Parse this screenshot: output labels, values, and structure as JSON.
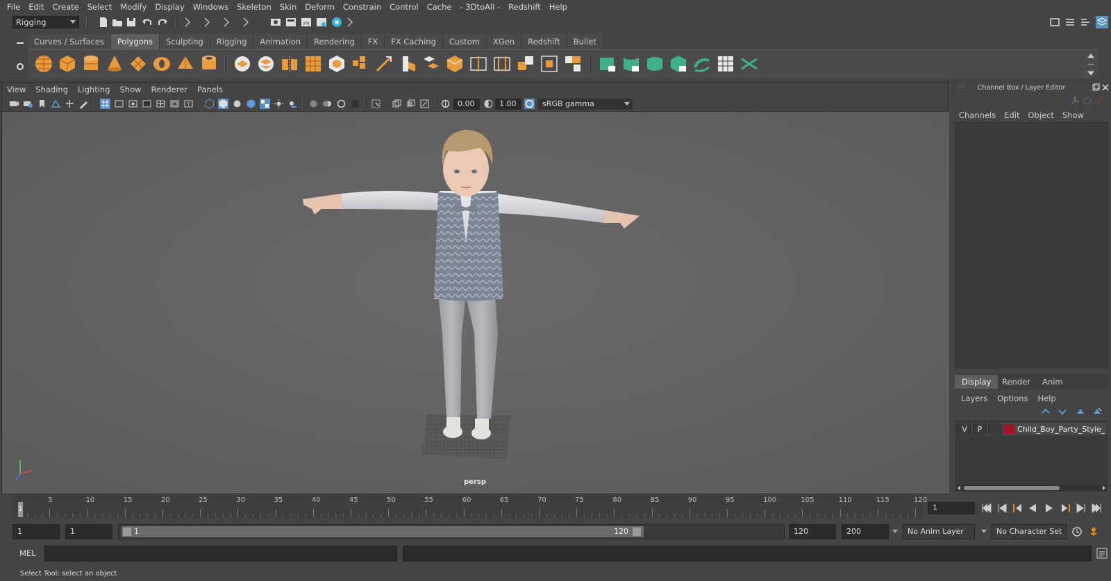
{
  "menubar": {
    "items": [
      "File",
      "Edit",
      "Create",
      "Select",
      "Modify",
      "Display",
      "Windows",
      "Skeleton",
      "Skin",
      "Deform",
      "Constrain",
      "Control",
      "Cache",
      "- 3DtoAll -",
      "Redshift",
      "Help"
    ]
  },
  "statusline": {
    "menuset": "Rigging"
  },
  "shelf": {
    "tabs": [
      "Curves / Surfaces",
      "Polygons",
      "Sculpting",
      "Rigging",
      "Animation",
      "Rendering",
      "FX",
      "FX Caching",
      "Custom",
      "XGen",
      "Redshift",
      "Bullet"
    ],
    "active_tab": "Polygons"
  },
  "viewport": {
    "menu": [
      "View",
      "Shading",
      "Lighting",
      "Show",
      "Renderer",
      "Panels"
    ],
    "exposure": "0.00",
    "gamma": "1.00",
    "color_space": "sRGB gamma",
    "camera": "persp"
  },
  "channel_box": {
    "title": "Channel Box / Layer Editor",
    "menu": [
      "Channels",
      "Edit",
      "Object",
      "Show"
    ]
  },
  "layer_editor": {
    "tabs": [
      "Display",
      "Render",
      "Anim"
    ],
    "active_tab": "Display",
    "menu": [
      "Layers",
      "Options",
      "Help"
    ],
    "layer": {
      "visible": "V",
      "playback": "P",
      "name": "Child_Boy_Party_Style_TF",
      "color": "#a8102a"
    }
  },
  "timeline": {
    "labels": [
      "1",
      "5",
      "10",
      "15",
      "20",
      "25",
      "30",
      "35",
      "40",
      "45",
      "50",
      "55",
      "60",
      "65",
      "70",
      "75",
      "80",
      "85",
      "90",
      "95",
      "100",
      "105",
      "110",
      "115",
      "120"
    ],
    "current_frame": "1"
  },
  "range": {
    "start": "1",
    "playback_start": "1",
    "slider_start": "1",
    "slider_end": "120",
    "playback_end": "120",
    "end": "200",
    "anim_layer": "No Anim Layer",
    "character_set": "No Character Set"
  },
  "cmdline": {
    "language": "MEL"
  },
  "helpline": {
    "text": "Select Tool: select an object"
  }
}
